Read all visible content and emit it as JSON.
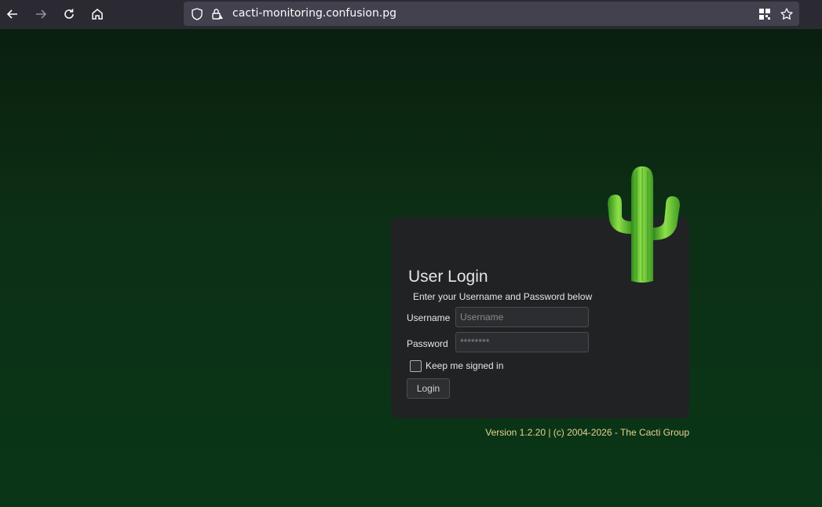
{
  "browser": {
    "url": "cacti-monitoring.confusion.pg"
  },
  "login": {
    "title": "User Login",
    "subtitle": "Enter your Username and Password below",
    "username_label": "Username",
    "username_placeholder": "Username",
    "password_label": "Password",
    "password_value": "********",
    "remember_label": "Keep me signed in",
    "remember_checked": false,
    "login_button": "Login"
  },
  "footer": {
    "version": "Version 1.2.20 | (c) 2004-2026 - The Cacti Group"
  },
  "colors": {
    "background_top": "#0a1f0e",
    "background_bottom": "#0a3617",
    "panel": "#212224",
    "version_text": "#e8d28f"
  },
  "icons": [
    "back-icon",
    "forward-icon",
    "reload-icon",
    "home-icon",
    "shield-icon",
    "insecure-lock-icon",
    "qr-code-icon",
    "bookmark-star-icon",
    "cactus-logo"
  ]
}
